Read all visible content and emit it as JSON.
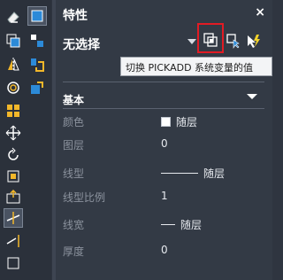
{
  "palette": {
    "title": "特性",
    "close_glyph": "×",
    "selection": "无选择",
    "tooltip": "切换 PICKADD 系统变量的值",
    "icons": [
      "toggle-pickadd-icon",
      "select-objects-icon",
      "quick-select-icon"
    ]
  },
  "section": {
    "title": "基本"
  },
  "properties": [
    {
      "label": "颜色",
      "value": "随层",
      "kind": "color-swatch"
    },
    {
      "label": "图层",
      "value": "0"
    },
    {
      "label": "线型",
      "value": "随层",
      "kind": "long-line"
    },
    {
      "label": "线型比例",
      "value": "1"
    },
    {
      "label": "线宽",
      "value": "随层",
      "kind": "short-line"
    },
    {
      "label": "厚度",
      "value": "0"
    }
  ],
  "toolbar": {
    "icons": [
      "eraser-icon",
      "copy-icon",
      "mirror-icon",
      "offset-icon",
      "array-icon",
      "move-icon",
      "rotate-icon",
      "scale-icon",
      "stretch-icon",
      "trim-icon",
      "extend-icon",
      "properties-icon",
      "match-properties-icon",
      "layer-icon",
      "edit-icon"
    ]
  },
  "colors": {
    "accent_red": "#e21b24",
    "bg": "#333a45",
    "text": "#e6e9ee",
    "label": "#8c939e"
  }
}
